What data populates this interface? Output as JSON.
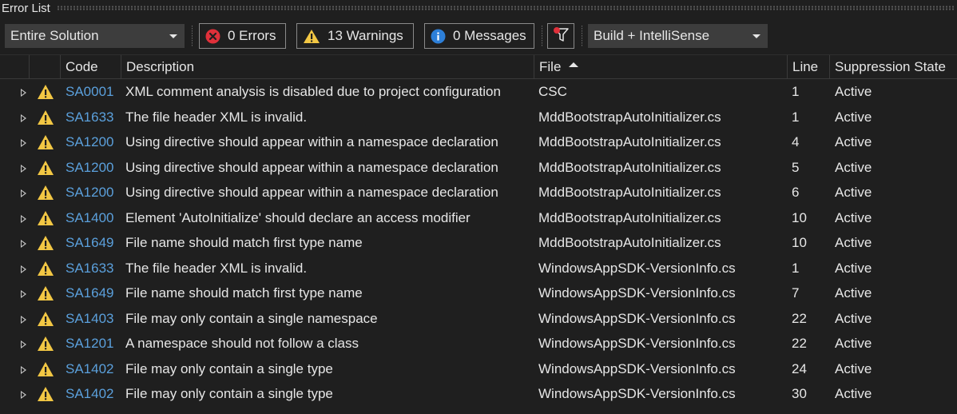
{
  "window": {
    "title": "Error List"
  },
  "toolbar": {
    "scope_dropdown": {
      "value": "Entire Solution"
    },
    "errors_filter": {
      "label": "0 Errors"
    },
    "warnings_filter": {
      "label": "13 Warnings"
    },
    "messages_filter": {
      "label": "0 Messages"
    },
    "build_dropdown": {
      "value": "Build + IntelliSense"
    }
  },
  "columns": {
    "code": "Code",
    "description": "Description",
    "file": "File",
    "line": "Line",
    "suppression": "Suppression State"
  },
  "sort": {
    "column": "File",
    "direction": "ascending"
  },
  "colors": {
    "background": "#1f1f1f",
    "code_link": "#5ba0dc",
    "warning_yellow": "#f2c744",
    "error_red": "#e0303a",
    "info_blue": "#2d7fd8"
  },
  "rows": [
    {
      "icon": "warning-icon",
      "code": "SA0001",
      "description": "XML comment analysis is disabled due to project configuration",
      "file": "CSC",
      "line": "1",
      "suppression": "Active"
    },
    {
      "icon": "warning-icon",
      "code": "SA1633",
      "description": "The file header XML is invalid.",
      "file": "MddBootstrapAutoInitializer.cs",
      "line": "1",
      "suppression": "Active"
    },
    {
      "icon": "warning-icon",
      "code": "SA1200",
      "description": "Using directive should appear within a namespace declaration",
      "file": "MddBootstrapAutoInitializer.cs",
      "line": "4",
      "suppression": "Active"
    },
    {
      "icon": "warning-icon",
      "code": "SA1200",
      "description": "Using directive should appear within a namespace declaration",
      "file": "MddBootstrapAutoInitializer.cs",
      "line": "5",
      "suppression": "Active"
    },
    {
      "icon": "warning-icon",
      "code": "SA1200",
      "description": "Using directive should appear within a namespace declaration",
      "file": "MddBootstrapAutoInitializer.cs",
      "line": "6",
      "suppression": "Active"
    },
    {
      "icon": "warning-icon",
      "code": "SA1400",
      "description": "Element 'AutoInitialize' should declare an access modifier",
      "file": "MddBootstrapAutoInitializer.cs",
      "line": "10",
      "suppression": "Active"
    },
    {
      "icon": "warning-icon",
      "code": "SA1649",
      "description": "File name should match first type name",
      "file": "MddBootstrapAutoInitializer.cs",
      "line": "10",
      "suppression": "Active"
    },
    {
      "icon": "warning-icon",
      "code": "SA1633",
      "description": "The file header XML is invalid.",
      "file": "WindowsAppSDK-VersionInfo.cs",
      "line": "1",
      "suppression": "Active"
    },
    {
      "icon": "warning-icon",
      "code": "SA1649",
      "description": "File name should match first type name",
      "file": "WindowsAppSDK-VersionInfo.cs",
      "line": "7",
      "suppression": "Active"
    },
    {
      "icon": "warning-icon",
      "code": "SA1403",
      "description": "File may only contain a single namespace",
      "file": "WindowsAppSDK-VersionInfo.cs",
      "line": "22",
      "suppression": "Active"
    },
    {
      "icon": "warning-icon",
      "code": "SA1201",
      "description": "A namespace should not follow a class",
      "file": "WindowsAppSDK-VersionInfo.cs",
      "line": "22",
      "suppression": "Active"
    },
    {
      "icon": "warning-icon",
      "code": "SA1402",
      "description": "File may only contain a single type",
      "file": "WindowsAppSDK-VersionInfo.cs",
      "line": "24",
      "suppression": "Active"
    },
    {
      "icon": "warning-icon",
      "code": "SA1402",
      "description": "File may only contain a single type",
      "file": "WindowsAppSDK-VersionInfo.cs",
      "line": "30",
      "suppression": "Active"
    }
  ]
}
